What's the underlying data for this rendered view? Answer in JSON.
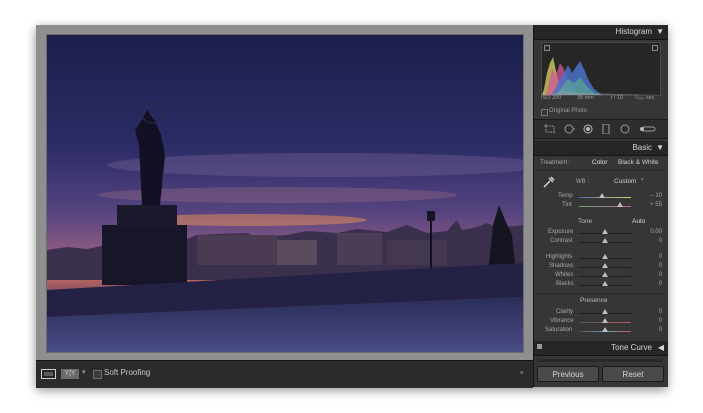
{
  "window": {
    "title": ""
  },
  "photo": {
    "alt": "Silhouette of a statue on a bridge at dusk over a city skyline"
  },
  "bottombar": {
    "soft_proofing_label": "Soft Proofing",
    "compare_label": "Y|Y"
  },
  "panels": {
    "histogram": {
      "title": "Histogram",
      "iso": "ISO 200",
      "focal": "39 mm",
      "aperture": "f / 10",
      "shutter": "¹⁄₂₅₀ sec",
      "original_photo_label": "Original Photo"
    },
    "basic": {
      "title": "Basic",
      "treatment_label": "Treatment :",
      "treatment_color": "Color",
      "treatment_bw": "Black & White",
      "wb_label": "WB :",
      "wb_value": "Custom",
      "temp_label": "Temp",
      "temp_value": "– 10",
      "tint_label": "Tint",
      "tint_value": "+ 55",
      "tone_label": "Tone",
      "tone_auto": "Auto",
      "exposure_label": "Exposure",
      "exposure_value": "0.00",
      "contrast_label": "Contrast",
      "contrast_value": "0",
      "highlights_label": "Highlights",
      "highlights_value": "0",
      "shadows_label": "Shadows",
      "shadows_value": "0",
      "whites_label": "Whites",
      "whites_value": "0",
      "blacks_label": "Blacks",
      "blacks_value": "0",
      "presence_label": "Presence",
      "clarity_label": "Clarity",
      "clarity_value": "0",
      "vibrance_label": "Vibrance",
      "vibrance_value": "0",
      "saturation_label": "Saturation",
      "saturation_value": "0"
    },
    "tone_curve": {
      "title": "Tone Curve"
    }
  },
  "buttons": {
    "previous": "Previous",
    "reset": "Reset"
  },
  "colors": {
    "panel_bg": "#363636",
    "header_bg": "#262626",
    "accent_text": "#d6d6d6"
  },
  "sliders": {
    "temp": 0.45,
    "tint": 0.78,
    "exposure": 0.5,
    "contrast": 0.5,
    "highlights": 0.5,
    "shadows": 0.5,
    "whites": 0.5,
    "blacks": 0.5,
    "clarity": 0.5,
    "vibrance": 0.5,
    "saturation": 0.5
  }
}
